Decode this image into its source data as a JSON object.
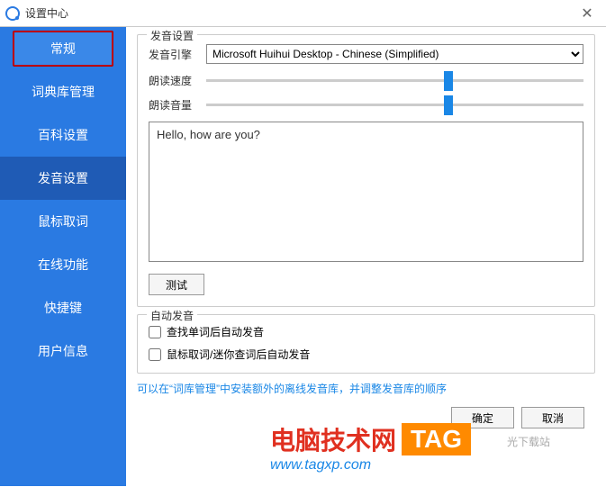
{
  "window": {
    "title": "设置中心"
  },
  "sidebar": {
    "items": [
      {
        "label": "常规"
      },
      {
        "label": "词典库管理"
      },
      {
        "label": "百科设置"
      },
      {
        "label": "发音设置"
      },
      {
        "label": "鼠标取词"
      },
      {
        "label": "在线功能"
      },
      {
        "label": "快捷键"
      },
      {
        "label": "用户信息"
      }
    ]
  },
  "voice": {
    "group_title": "发音设置",
    "engine_label": "发音引擎",
    "engine_value": "Microsoft Huihui Desktop - Chinese (Simplified)",
    "speed_label": "朗读速度",
    "speed_value": 75,
    "volume_label": "朗读音量",
    "volume_value": 75,
    "sample_text": "Hello, how are you?",
    "test_button": "测试"
  },
  "auto": {
    "group_title": "自动发音",
    "cb_search": "查找单词后自动发音",
    "cb_mouse": "鼠标取词/迷你查词后自动发音"
  },
  "hint": "可以在“词库管理”中安装额外的离线发音库，并调整发音库的顺序",
  "buttons": {
    "ok": "确定",
    "cancel": "取消"
  },
  "watermark": {
    "brand": "电脑技术网",
    "tag": "TAG",
    "url": "www.tagxp.com",
    "side": "光下载站"
  }
}
